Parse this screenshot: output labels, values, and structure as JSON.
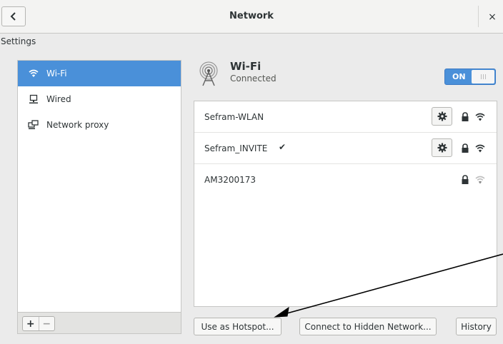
{
  "header": {
    "title": "Network",
    "back_icon": "chevron-left-icon",
    "close_label": "×"
  },
  "settings_label": "Settings",
  "sidebar": {
    "items": [
      {
        "label": "Wi-Fi",
        "icon": "wifi-icon",
        "selected": true
      },
      {
        "label": "Wired",
        "icon": "wired-network-icon",
        "selected": false
      },
      {
        "label": "Network proxy",
        "icon": "network-proxy-icon",
        "selected": false
      }
    ],
    "add_label": "+",
    "remove_label": "−"
  },
  "wifi": {
    "title": "Wi-Fi",
    "status": "Connected",
    "toggle_label": "ON",
    "toggle_state": true
  },
  "networks": [
    {
      "name": "Sefram-WLAN",
      "connected": false,
      "has_settings": true,
      "secured": true,
      "signal": "strong"
    },
    {
      "name": "Sefram_INVITE",
      "connected": true,
      "check": "✔",
      "has_settings": true,
      "secured": true,
      "signal": "strong"
    },
    {
      "name": "AM3200173",
      "connected": false,
      "has_settings": false,
      "secured": true,
      "signal": "weak"
    }
  ],
  "buttons": {
    "hotspot": "Use as Hotspot...",
    "hidden": "Connect to Hidden Network...",
    "history": "History"
  },
  "colors": {
    "accent": "#4a90d9",
    "annotation_arrow": "#000000"
  }
}
